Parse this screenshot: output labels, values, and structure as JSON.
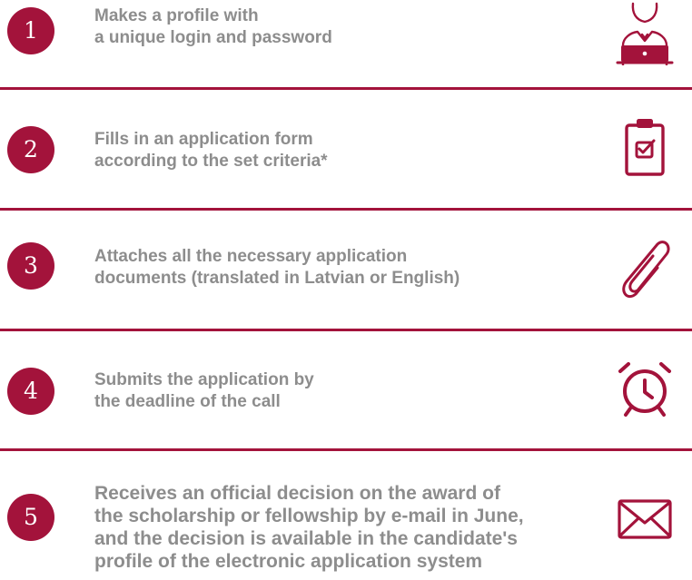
{
  "colors": {
    "accent": "#a3133b",
    "text": "#8d8d8d",
    "background": "#ffffff"
  },
  "steps": [
    {
      "number": "1",
      "line1": "Makes a profile with",
      "line2": "a unique login and password",
      "icon": "user-laptop-icon"
    },
    {
      "number": "2",
      "line1": "Fills in an application form",
      "line2": "according to the set criteria*",
      "icon": "clipboard-check-icon"
    },
    {
      "number": "3",
      "line1": "Attaches all the necessary application",
      "line2": "documents (translated in Latvian or English)",
      "icon": "paperclip-icon"
    },
    {
      "number": "4",
      "line1": "Submits the application by",
      "line2": "the deadline of the call",
      "icon": "alarm-clock-icon"
    },
    {
      "number": "5",
      "line1": "Receives an official decision on the award of",
      "line2": "the scholarship or fellowship by e-mail in June,",
      "line3": "and the decision is available in the candidate's",
      "line4": "profile of the electronic application system",
      "icon": "envelope-icon"
    }
  ]
}
